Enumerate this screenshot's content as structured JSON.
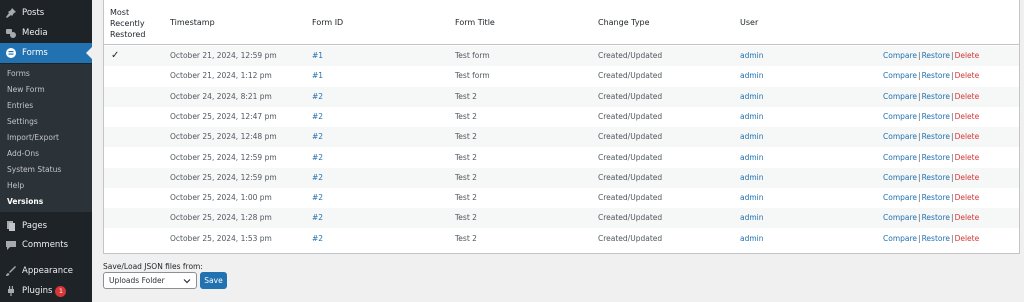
{
  "sidebar": {
    "items": [
      {
        "label": "Posts",
        "icon": "pin-icon"
      },
      {
        "label": "Media",
        "icon": "media-icon"
      },
      {
        "label": "Forms",
        "icon": "forms-icon"
      },
      {
        "label": "Pages",
        "icon": "pages-icon"
      },
      {
        "label": "Comments",
        "icon": "comments-icon"
      },
      {
        "label": "Appearance",
        "icon": "appearance-icon"
      },
      {
        "label": "Plugins",
        "icon": "plugins-icon",
        "badge": "1"
      }
    ],
    "submenu": [
      "Forms",
      "New Form",
      "Entries",
      "Settings",
      "Import/Export",
      "Add-Ons",
      "System Status",
      "Help",
      "Versions"
    ],
    "current_submenu": "Versions"
  },
  "table": {
    "headers": {
      "restored": "Most Recently Restored",
      "restored_lines": [
        "Most",
        "Recently",
        "Restored"
      ],
      "timestamp": "Timestamp",
      "form_id": "Form ID",
      "form_title": "Form Title",
      "change_type": "Change Type",
      "user": "User"
    },
    "actions": {
      "compare": "Compare",
      "restore": "Restore",
      "delete": "Delete",
      "separator": "|"
    },
    "rows": [
      {
        "restored": "✓",
        "timestamp": "October 21, 2024, 12:59 pm",
        "form_id": "#1",
        "form_title": "Test form",
        "change_type": "Created/Updated",
        "user": "admin"
      },
      {
        "restored": "",
        "timestamp": "October 21, 2024, 1:12 pm",
        "form_id": "#1",
        "form_title": "Test form",
        "change_type": "Created/Updated",
        "user": "admin"
      },
      {
        "restored": "",
        "timestamp": "October 24, 2024, 8:21 pm",
        "form_id": "#2",
        "form_title": "Test 2",
        "change_type": "Created/Updated",
        "user": "admin"
      },
      {
        "restored": "",
        "timestamp": "October 25, 2024, 12:47 pm",
        "form_id": "#2",
        "form_title": "Test 2",
        "change_type": "Created/Updated",
        "user": "admin"
      },
      {
        "restored": "",
        "timestamp": "October 25, 2024, 12:48 pm",
        "form_id": "#2",
        "form_title": "Test 2",
        "change_type": "Created/Updated",
        "user": "admin"
      },
      {
        "restored": "",
        "timestamp": "October 25, 2024, 12:59 pm",
        "form_id": "#2",
        "form_title": "Test 2",
        "change_type": "Created/Updated",
        "user": "admin"
      },
      {
        "restored": "",
        "timestamp": "October 25, 2024, 12:59 pm",
        "form_id": "#2",
        "form_title": "Test 2",
        "change_type": "Created/Updated",
        "user": "admin"
      },
      {
        "restored": "",
        "timestamp": "October 25, 2024, 1:00 pm",
        "form_id": "#2",
        "form_title": "Test 2",
        "change_type": "Created/Updated",
        "user": "admin"
      },
      {
        "restored": "",
        "timestamp": "October 25, 2024, 1:28 pm",
        "form_id": "#2",
        "form_title": "Test 2",
        "change_type": "Created/Updated",
        "user": "admin"
      },
      {
        "restored": "",
        "timestamp": "October 25, 2024, 1:53 pm",
        "form_id": "#2",
        "form_title": "Test 2",
        "change_type": "Created/Updated",
        "user": "admin"
      }
    ]
  },
  "footer": {
    "label": "Save/Load JSON files from:",
    "select_value": "Uploads Folder",
    "save_label": "Save"
  },
  "colors": {
    "sidebar_bg": "#1d2327",
    "submenu_bg": "#2c3338",
    "accent": "#2271b1",
    "delete": "#d63638"
  }
}
